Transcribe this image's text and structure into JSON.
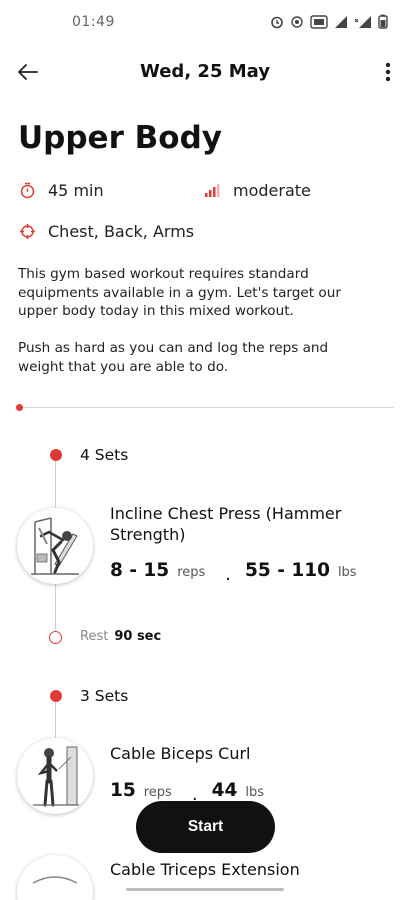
{
  "status_bar": {
    "time": "01:49"
  },
  "app_bar": {
    "title": "Wed, 25 May"
  },
  "workout": {
    "title": "Upper Body",
    "duration": "45 min",
    "intensity": "moderate",
    "focus": "Chest, Back, Arms",
    "description_1": "This gym based workout requires standard equipments available in a gym. Let's target our upper body today in this mixed workout.",
    "description_2": "Push as hard as you can and log the reps and weight that you are able to do."
  },
  "progress": {
    "fraction": 0.0
  },
  "blocks": [
    {
      "sets": "4 Sets",
      "exercise": {
        "name": "Incline Chest Press (Hammer Strength)",
        "reps": "8 - 15",
        "reps_unit": "reps",
        "weight": "55 - 110",
        "weight_unit": "lbs"
      },
      "rest_label": "Rest",
      "rest_value": "90 sec"
    },
    {
      "sets": "3 Sets",
      "exercise": {
        "name": "Cable Biceps Curl",
        "reps": "15",
        "reps_unit": "reps",
        "weight": "44",
        "weight_unit": "lbs"
      }
    },
    {
      "exercise": {
        "name": "Cable Triceps Extension"
      }
    }
  ],
  "actions": {
    "start": "Start"
  },
  "colors": {
    "accent": "#e53935",
    "button": "#111111"
  }
}
